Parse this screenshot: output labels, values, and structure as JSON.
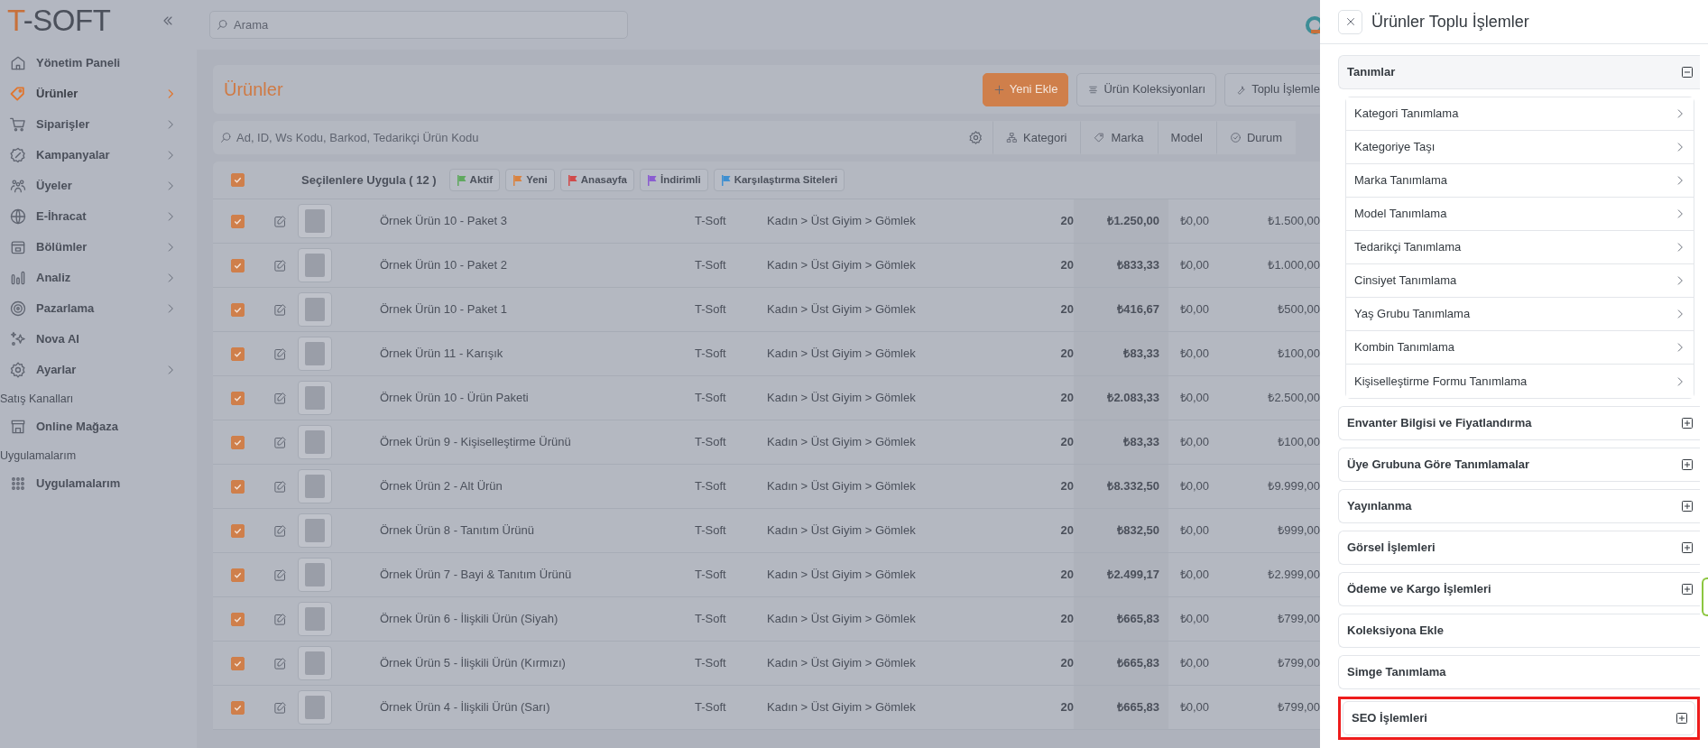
{
  "sidebar": {
    "logo": "T-SOFT",
    "items": [
      {
        "label": "Yönetim Paneli",
        "selected": false,
        "has_submenu": false
      },
      {
        "label": "Ürünler",
        "selected": true,
        "has_submenu": true
      },
      {
        "label": "Siparişler",
        "selected": false,
        "has_submenu": true
      },
      {
        "label": "Kampanyalar",
        "selected": false,
        "has_submenu": true
      },
      {
        "label": "Üyeler",
        "selected": false,
        "has_submenu": true
      },
      {
        "label": "E-İhracat",
        "selected": false,
        "has_submenu": true
      },
      {
        "label": "Bölümler",
        "selected": false,
        "has_submenu": true
      },
      {
        "label": "Analiz",
        "selected": false,
        "has_submenu": true
      },
      {
        "label": "Pazarlama",
        "selected": false,
        "has_submenu": true
      },
      {
        "label": "Nova AI",
        "selected": false,
        "has_submenu": false
      },
      {
        "label": "Ayarlar",
        "selected": false,
        "has_submenu": true
      }
    ],
    "sections": [
      {
        "title": "Satış Kanalları",
        "items": [
          {
            "label": "Online Mağaza"
          }
        ]
      },
      {
        "title": "Uygulamalarım",
        "items": [
          {
            "label": "Uygulamalarım"
          }
        ]
      }
    ]
  },
  "search": {
    "placeholder": "Arama"
  },
  "page": {
    "title": "Ürünler",
    "buttons": [
      {
        "label": "Yeni Ekle",
        "kind": "primary"
      },
      {
        "label": "Ürün Koleksiyonları",
        "kind": "list"
      },
      {
        "label": "Toplu İşlemle",
        "kind": "tools"
      }
    ]
  },
  "filters": {
    "placeholder": "Ad, ID, Ws Kodu, Barkod, Tedarikçi Ürün Kodu",
    "segments": [
      "Kategori",
      "Marka",
      "Model",
      "Durum"
    ]
  },
  "bulk": {
    "checked": true,
    "label": "Seçilenlere Uygula ( 12 )",
    "tags": [
      {
        "label": "Aktif",
        "color": "#5fa85f"
      },
      {
        "label": "Yeni",
        "color": "#d9823f"
      },
      {
        "label": "Anasayfa",
        "color": "#d04a4a"
      },
      {
        "label": "İndirimli",
        "color": "#8a5cd0"
      },
      {
        "label": "Karşılaştırma Siteleri",
        "color": "#3f8fd0"
      }
    ]
  },
  "table": {
    "rows": [
      {
        "checked": true,
        "column_4": "Örnek Ürün 10 - Paket 3",
        "column_5": "T-Soft",
        "column_6": "Kadın > Üst Giyim > Gömlek",
        "column_7": "20",
        "column_8": "₺1.250,00",
        "column_9": "₺0,00",
        "column_10": "₺1.500,00"
      },
      {
        "checked": true,
        "column_4": "Örnek Ürün 10 - Paket 2",
        "column_5": "T-Soft",
        "column_6": "Kadın > Üst Giyim > Gömlek",
        "column_7": "20",
        "column_8": "₺833,33",
        "column_9": "₺0,00",
        "column_10": "₺1.000,00"
      },
      {
        "checked": true,
        "column_4": "Örnek Ürün 10 - Paket 1",
        "column_5": "T-Soft",
        "column_6": "Kadın > Üst Giyim > Gömlek",
        "column_7": "20",
        "column_8": "₺416,67",
        "column_9": "₺0,00",
        "column_10": "₺500,00"
      },
      {
        "checked": true,
        "column_4": "Örnek Ürün 11 - Karışık",
        "column_5": "T-Soft",
        "column_6": "Kadın > Üst Giyim > Gömlek",
        "column_7": "20",
        "column_8": "₺83,33",
        "column_9": "₺0,00",
        "column_10": "₺100,00"
      },
      {
        "checked": true,
        "column_4": "Örnek Ürün 10 - Ürün Paketi",
        "column_5": "T-Soft",
        "column_6": "Kadın > Üst Giyim > Gömlek",
        "column_7": "20",
        "column_8": "₺2.083,33",
        "column_9": "₺0,00",
        "column_10": "₺2.500,00"
      },
      {
        "checked": true,
        "column_4": "Örnek Ürün 9 - Kişiselleştirme Ürünü",
        "column_5": "T-Soft",
        "column_6": "Kadın > Üst Giyim > Gömlek",
        "column_7": "20",
        "column_8": "₺83,33",
        "column_9": "₺0,00",
        "column_10": "₺100,00"
      },
      {
        "checked": true,
        "column_4": "Örnek Ürün 2 - Alt Ürün",
        "column_5": "T-Soft",
        "column_6": "Kadın > Üst Giyim > Gömlek",
        "column_7": "20",
        "column_8": "₺8.332,50",
        "column_9": "₺0,00",
        "column_10": "₺9.999,00"
      },
      {
        "checked": true,
        "column_4": "Örnek Ürün 8 - Tanıtım Ürünü",
        "column_5": "T-Soft",
        "column_6": "Kadın > Üst Giyim > Gömlek",
        "column_7": "20",
        "column_8": "₺832,50",
        "column_9": "₺0,00",
        "column_10": "₺999,00"
      },
      {
        "checked": true,
        "column_4": "Örnek Ürün 7 - Bayi & Tanıtım Ürünü",
        "column_5": "T-Soft",
        "column_6": "Kadın > Üst Giyim > Gömlek",
        "column_7": "20",
        "column_8": "₺2.499,17",
        "column_9": "₺0,00",
        "column_10": "₺2.999,00"
      },
      {
        "checked": true,
        "column_4": "Örnek Ürün 6 - İlişkili Ürün (Siyah)",
        "column_5": "T-Soft",
        "column_6": "Kadın > Üst Giyim > Gömlek",
        "column_7": "20",
        "column_8": "₺665,83",
        "column_9": "₺0,00",
        "column_10": "₺799,00"
      },
      {
        "checked": true,
        "column_4": "Örnek Ürün 5 - İlişkili Ürün (Kırmızı)",
        "column_5": "T-Soft",
        "column_6": "Kadın > Üst Giyim > Gömlek",
        "column_7": "20",
        "column_8": "₺665,83",
        "column_9": "₺0,00",
        "column_10": "₺799,00"
      },
      {
        "checked": true,
        "column_4": "Örnek Ürün 4 - İlişkili Ürün (Sarı)",
        "column_5": "T-Soft",
        "column_6": "Kadın > Üst Giyim > Gömlek",
        "column_7": "20",
        "column_8": "₺665,83",
        "column_9": "₺0,00",
        "column_10": "₺799,00"
      }
    ]
  },
  "panel": {
    "title": "Ürünler Toplu İşlemler",
    "sections": [
      {
        "title": "Tanımlar",
        "kind": "accordion",
        "expanded": true,
        "highlighted": false,
        "items": [
          "Kategori Tanımlama",
          "Kategoriye Taşı",
          "Marka Tanımlama",
          "Model Tanımlama",
          "Tedarikçi Tanımlama",
          "Cinsiyet Tanımlama",
          "Yaş Grubu Tanımlama",
          "Kombin Tanımlama",
          "Kişiselleştirme Formu Tanımlama"
        ]
      },
      {
        "title": "Envanter Bilgisi ve Fiyatlandırma",
        "kind": "accordion",
        "expanded": false,
        "highlighted": false
      },
      {
        "title": "Üye Grubuna Göre Tanımlamalar",
        "kind": "accordion",
        "expanded": false,
        "highlighted": false
      },
      {
        "title": "Yayınlanma",
        "kind": "accordion",
        "expanded": false,
        "highlighted": false
      },
      {
        "title": "Görsel İşlemleri",
        "kind": "accordion",
        "expanded": false,
        "highlighted": false
      },
      {
        "title": "Ödeme ve Kargo İşlemleri",
        "kind": "accordion",
        "expanded": false,
        "highlighted": false
      },
      {
        "title": "Koleksiyona Ekle",
        "kind": "link",
        "highlighted": false
      },
      {
        "title": "Simge Tanımlama",
        "kind": "link",
        "highlighted": false
      },
      {
        "title": "SEO İşlemleri",
        "kind": "accordion",
        "expanded": false,
        "highlighted": true
      }
    ]
  }
}
